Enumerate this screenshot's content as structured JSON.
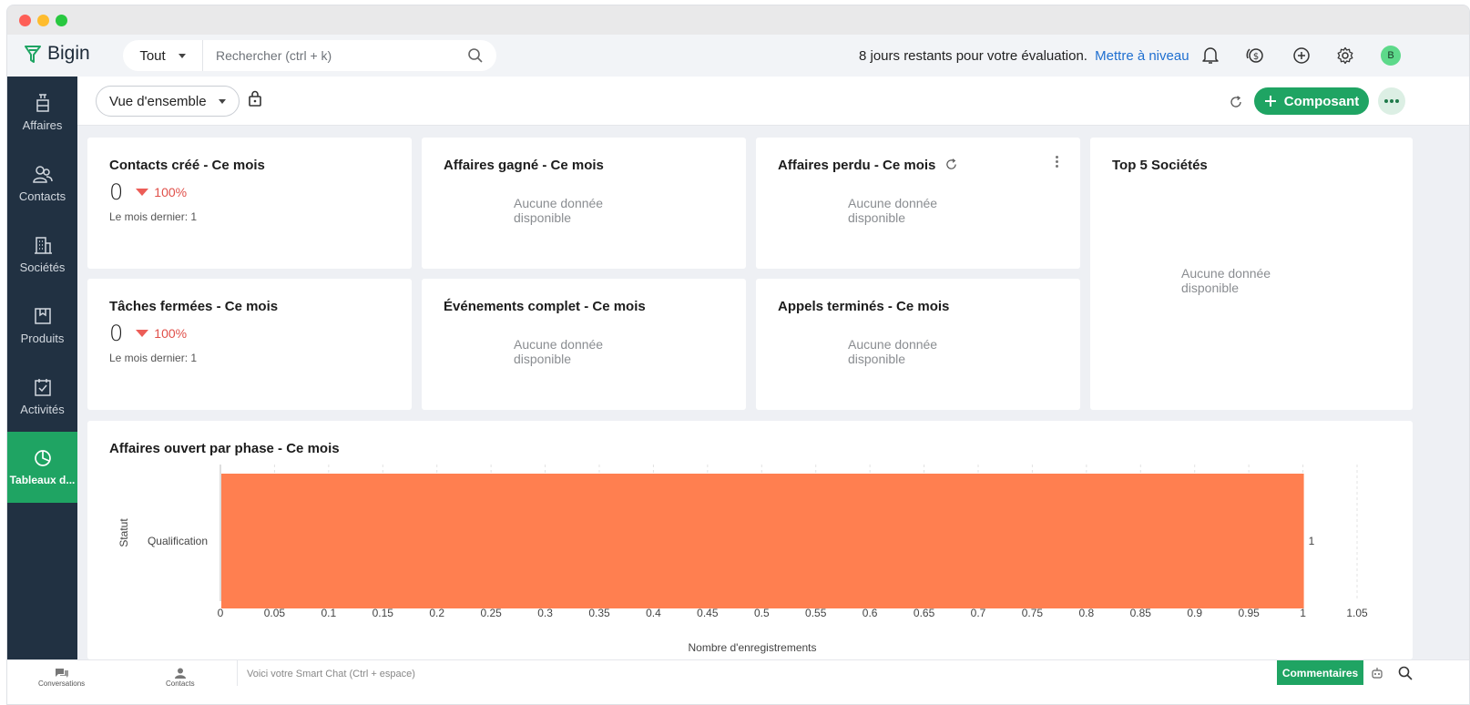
{
  "app": {
    "name": "Bigin"
  },
  "search": {
    "scope": "Tout",
    "placeholder": "Rechercher (ctrl + k)"
  },
  "trial": {
    "message": "8 jours restants pour votre évaluation.",
    "upgrade_link": "Mettre à niveau"
  },
  "user": {
    "initial": "B"
  },
  "sidebar": {
    "items": [
      {
        "label": "Affaires",
        "icon": "deals-icon"
      },
      {
        "label": "Contacts",
        "icon": "contacts-icon"
      },
      {
        "label": "Sociétés",
        "icon": "companies-icon"
      },
      {
        "label": "Produits",
        "icon": "products-icon"
      },
      {
        "label": "Activités",
        "icon": "activities-icon"
      },
      {
        "label": "Tableaux d...",
        "icon": "dashboard-icon",
        "active": true
      }
    ]
  },
  "toolbar": {
    "view": "Vue d'ensemble",
    "add_component": "Composant"
  },
  "cards": {
    "contacts": {
      "title": "Contacts créé - Ce mois",
      "value": "0",
      "change": "100%",
      "last_month": "Le mois dernier: 1"
    },
    "deals_won": {
      "title": "Affaires gagné - Ce mois",
      "no_data": "Aucune donnée disponible"
    },
    "deals_lost": {
      "title": "Affaires perdu - Ce mois",
      "no_data": "Aucune donnée disponible"
    },
    "top_companies": {
      "title": "Top 5 Sociétés",
      "no_data": "Aucune donnée disponible"
    },
    "tasks": {
      "title": "Tâches fermées - Ce mois",
      "value": "0",
      "change": "100%",
      "last_month": "Le mois dernier: 1"
    },
    "events": {
      "title": "Événements complet - Ce mois",
      "no_data": "Aucune donnée disponible"
    },
    "calls": {
      "title": "Appels terminés - Ce mois",
      "no_data": "Aucune donnée disponible"
    }
  },
  "chart_data": {
    "type": "bar",
    "orientation": "horizontal",
    "title": "Affaires ouvert par phase - Ce mois",
    "ylabel": "Statut",
    "xlabel": "Nombre d'enregistrements",
    "categories": [
      "Qualification"
    ],
    "values": [
      1
    ],
    "xlim": [
      0,
      1.05
    ],
    "xticks": [
      "0",
      "0.05",
      "0.1",
      "0.15",
      "0.2",
      "0.25",
      "0.3",
      "0.35",
      "0.4",
      "0.45",
      "0.5",
      "0.55",
      "0.6",
      "0.65",
      "0.7",
      "0.75",
      "0.8",
      "0.85",
      "0.9",
      "0.95",
      "1",
      "1.05"
    ],
    "data_labels": [
      "1"
    ],
    "bar_color": "#ff7f50",
    "grid": true
  },
  "bottombar": {
    "conversations": "Conversations",
    "contacts": "Contacts",
    "smartchat": "Voici votre Smart Chat (Ctrl + espace)",
    "comments": "Commentaires"
  },
  "colors": {
    "accent": "#1fa463",
    "sidebar": "#213142",
    "link": "#1f6fd0",
    "decline": "#e0504a"
  }
}
